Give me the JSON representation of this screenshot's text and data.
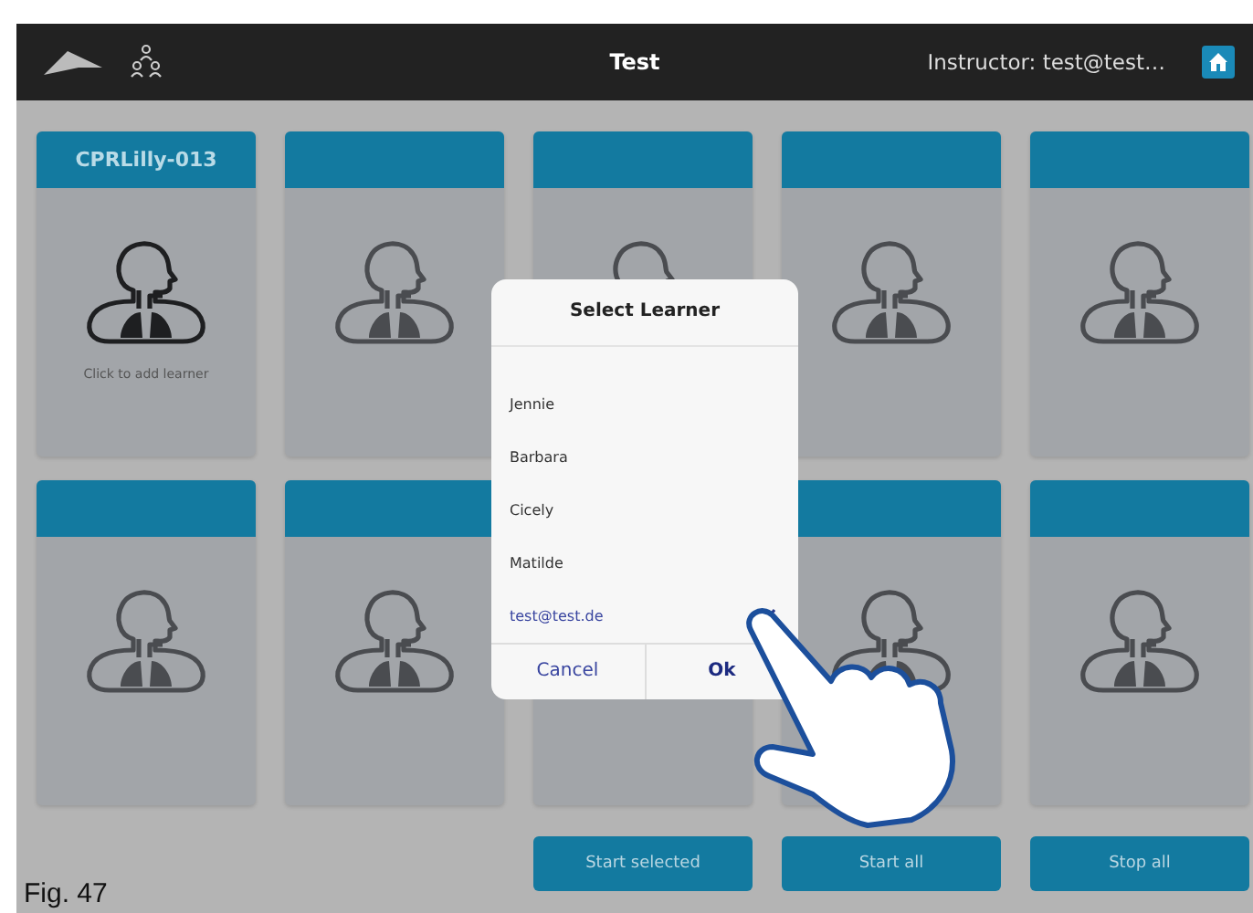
{
  "header": {
    "title": "Test",
    "instructor": "Instructor: test@test…"
  },
  "stations": [
    {
      "kind": "station",
      "name": "CPRLilly-013",
      "note": "Click to add learner",
      "selected": true
    },
    {
      "kind": "station",
      "selected": false
    },
    {
      "kind": "station",
      "selected": false
    },
    {
      "kind": "station",
      "selected": false
    },
    {
      "kind": "station",
      "selected": false
    },
    {
      "kind": "station",
      "selected": false
    },
    {
      "kind": "station",
      "selected": false
    },
    {
      "kind": "blank"
    },
    {
      "kind": "station",
      "selected": false
    },
    {
      "kind": "station",
      "selected": false
    }
  ],
  "dialog": {
    "title": "Select Learner",
    "learners": [
      {
        "name": "Jennie",
        "selected": false
      },
      {
        "name": "Barbara",
        "selected": false
      },
      {
        "name": "Cicely",
        "selected": false
      },
      {
        "name": "Matilde",
        "selected": false
      },
      {
        "name": "test@test.de",
        "selected": true
      }
    ],
    "buttons": [
      {
        "label": "Cancel",
        "kind": "cancel"
      },
      {
        "label": "Ok",
        "kind": "confirm"
      }
    ]
  },
  "actions": [
    "Start selected",
    "Start all",
    "Stop all"
  ],
  "caption": "Fig. 47"
}
